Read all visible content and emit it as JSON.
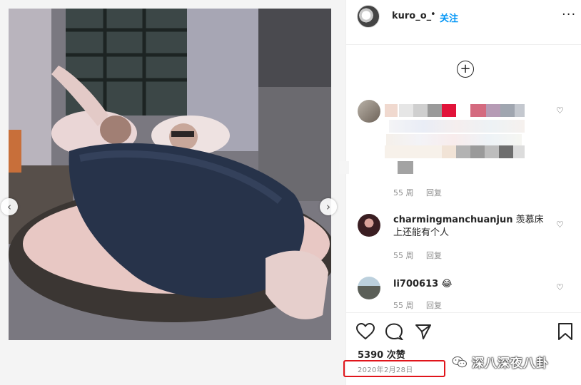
{
  "header": {
    "username": "kuro_o_",
    "separator": "•",
    "follow_label": "关注",
    "more_label": "···"
  },
  "icons": {
    "add": "plus-circle-icon",
    "like": "heart-icon",
    "comment": "speech-bubble-icon",
    "share": "paper-plane-icon",
    "save": "bookmark-icon"
  },
  "comments": [
    {
      "username": "",
      "text": "",
      "time": "55 周",
      "reply_label": "回复",
      "note": "pixelated"
    },
    {
      "username": "charmingmanchuanjun",
      "text": "羡慕床上还能有个人",
      "time": "55 周",
      "reply_label": "回复"
    },
    {
      "username": "li700613",
      "text": "😂",
      "time": "55 周",
      "reply_label": "回复"
    }
  ],
  "actions": {
    "likes": "5390 次赞",
    "date": "2020年2月28日"
  },
  "watermark": {
    "text": "深八深夜八卦"
  },
  "colors": {
    "follow": "#0095f6",
    "highlight_box": "#e0151b",
    "meta_text": "#8e8e8e"
  }
}
